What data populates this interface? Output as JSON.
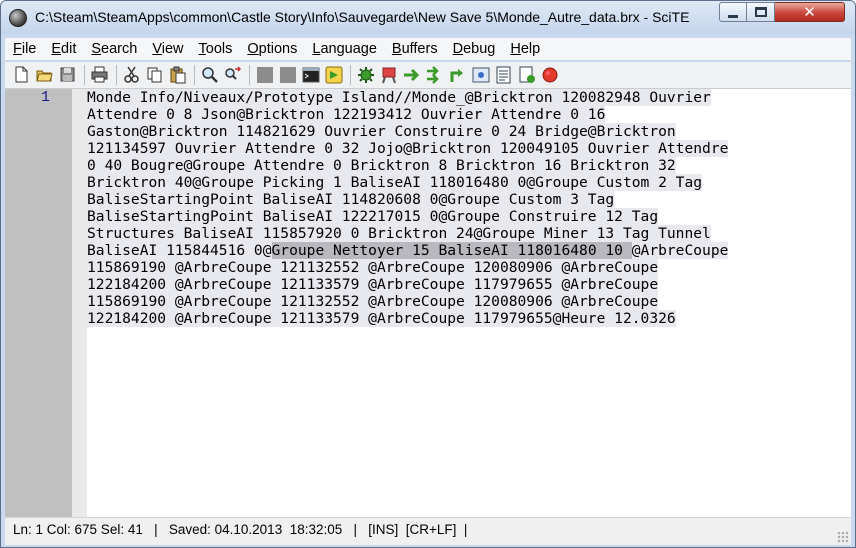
{
  "window": {
    "title": "C:\\Steam\\SteamApps\\common\\Castle Story\\Info\\Sauvegarde\\New Save 5\\Monde_Autre_data.brx - SciTE",
    "close_glyph": "✕"
  },
  "menu": [
    {
      "pre": "",
      "u": "F",
      "post": "ile"
    },
    {
      "pre": "",
      "u": "E",
      "post": "dit"
    },
    {
      "pre": "",
      "u": "S",
      "post": "earch"
    },
    {
      "pre": "",
      "u": "V",
      "post": "iew"
    },
    {
      "pre": "",
      "u": "T",
      "post": "ools"
    },
    {
      "pre": "",
      "u": "O",
      "post": "ptions"
    },
    {
      "pre": "",
      "u": "L",
      "post": "anguage"
    },
    {
      "pre": "",
      "u": "B",
      "post": "uffers"
    },
    {
      "pre": "",
      "u": "D",
      "post": "ebug"
    },
    {
      "pre": "",
      "u": "H",
      "post": "elp"
    }
  ],
  "toolbar": {
    "icons": [
      "new-file-icon",
      "open-folder-icon",
      "save-disk-icon",
      "|",
      "print-icon",
      "|",
      "cut-icon",
      "copy-icon",
      "paste-icon",
      "|",
      "find-icon",
      "replace-icon",
      "|",
      "undo-disabled-icon",
      "redo-disabled-icon",
      "terminal-icon",
      "go-icon",
      "|",
      "compile-icon",
      "build-icon",
      "run-icon",
      "go-arrow-icon",
      "step-icon",
      "view-icon",
      "properties-icon",
      "macro-icon",
      "stop-icon"
    ],
    "colors": {
      "accent": "#3a9a2a",
      "stop": "#e23a2a",
      "gray": "#8c8c8c"
    }
  },
  "editor": {
    "line_number": "1",
    "lines": [
      {
        "text": "Monde Info/Niveaux/Prototype Island//Monde_@Bricktron 120082948 Ouvrier"
      },
      {
        "text": "Attendre 0 8 Json@Bricktron 122193412 Ouvrier Attendre 0 16"
      },
      {
        "text": "Gaston@Bricktron 114821629 Ouvrier Construire 0 24 Bridge@Bricktron"
      },
      {
        "text": "121134597 Ouvrier Attendre 0 32 Jojo@Bricktron 120049105 Ouvrier Attendre"
      },
      {
        "text": "0 40 Bougre@Groupe Attendre 0 Bricktron 8 Bricktron 16 Bricktron 32"
      },
      {
        "text": "Bricktron 40@Groupe Picking 1 BaliseAI 118016480 0@Groupe Custom 2 Tag"
      },
      {
        "text": "BaliseStartingPoint BaliseAI 114820608 0@Groupe Custom 3 Tag"
      },
      {
        "text": "BaliseStartingPoint BaliseAI 122217015 0@Groupe Construire 12 Tag"
      },
      {
        "text": "Structures BaliseAI 115857920 0 Bricktron 24@Groupe Miner 13 Tag Tunnel"
      },
      {
        "pre": "BaliseAI 115844516 0@",
        "sel": "Groupe Nettoyer 15 BaliseAI 118016480 10 ",
        "post": "@ArbreCoupe"
      },
      {
        "text": "115869190 @ArbreCoupe 121132552 @ArbreCoupe 120080906 @ArbreCoupe"
      },
      {
        "text": "122184200 @ArbreCoupe 121133579 @ArbreCoupe 117979655 @ArbreCoupe"
      },
      {
        "text": "115869190 @ArbreCoupe 121132552 @ArbreCoupe 120080906 @ArbreCoupe"
      },
      {
        "text": "122184200 @ArbreCoupe 121133579 @ArbreCoupe 117979655@Heure 12.0326"
      }
    ]
  },
  "status": {
    "text": "Ln: 1 Col: 675 Sel: 41   |   Saved: 04.10.2013  18:32:05   |   [INS]  [CR+LF]  |"
  }
}
